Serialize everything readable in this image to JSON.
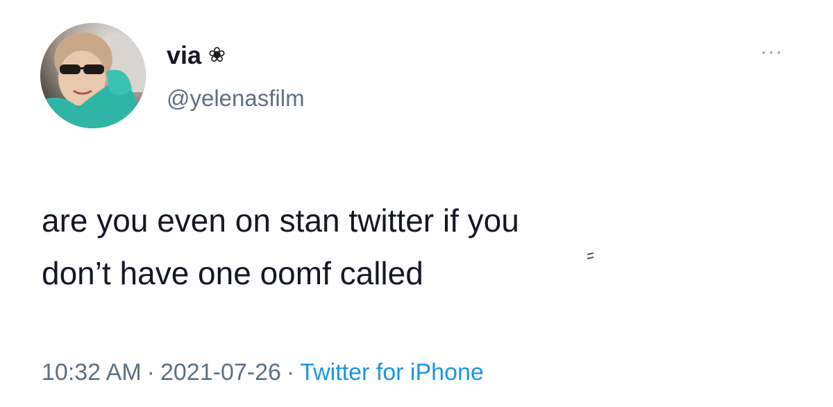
{
  "user": {
    "display_name": "via",
    "name_icon": "flower-icon",
    "name_icon_glyph": "❀",
    "handle": "@yelenasfilm"
  },
  "menu": {
    "icon": "more-options-icon",
    "glyph": "···"
  },
  "tweet": {
    "line1": "are you even on stan twitter if you",
    "line2": "don’t have one oomf called"
  },
  "meta": {
    "time": "10:32 AM",
    "separator": "·",
    "date": "2021-07-26",
    "source": "Twitter for iPhone",
    "source_color": "#1b95e0"
  }
}
